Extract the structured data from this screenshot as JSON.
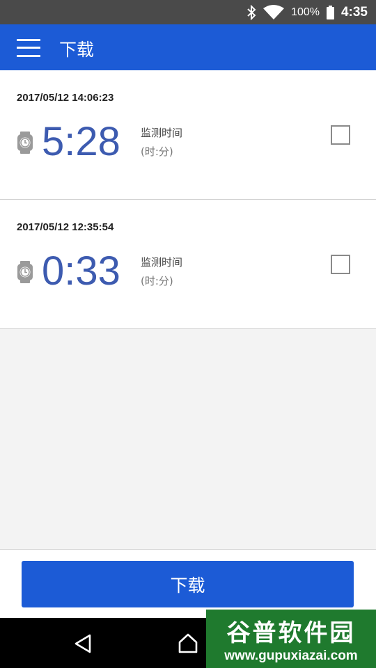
{
  "status_bar": {
    "battery_percent": "100%",
    "time": "4:35",
    "icons": [
      "bluetooth-icon",
      "wifi-icon",
      "battery-icon"
    ]
  },
  "app_bar": {
    "title": "下载",
    "menu_icon": "hamburger-menu-icon",
    "color": "#1c5bd6"
  },
  "records": [
    {
      "datetime": "2017/05/12 14:06:23",
      "duration": "5:28",
      "label": "监测时间",
      "unit": "(时:分)",
      "checked": false
    },
    {
      "datetime": "2017/05/12 12:35:54",
      "duration": "0:33",
      "label": "监测时间",
      "unit": "(时:分)",
      "checked": false
    }
  ],
  "download_button": {
    "label": "下载"
  },
  "watermark": {
    "brand": "谷普软件园",
    "url": "www.gupuxiazai.com"
  }
}
